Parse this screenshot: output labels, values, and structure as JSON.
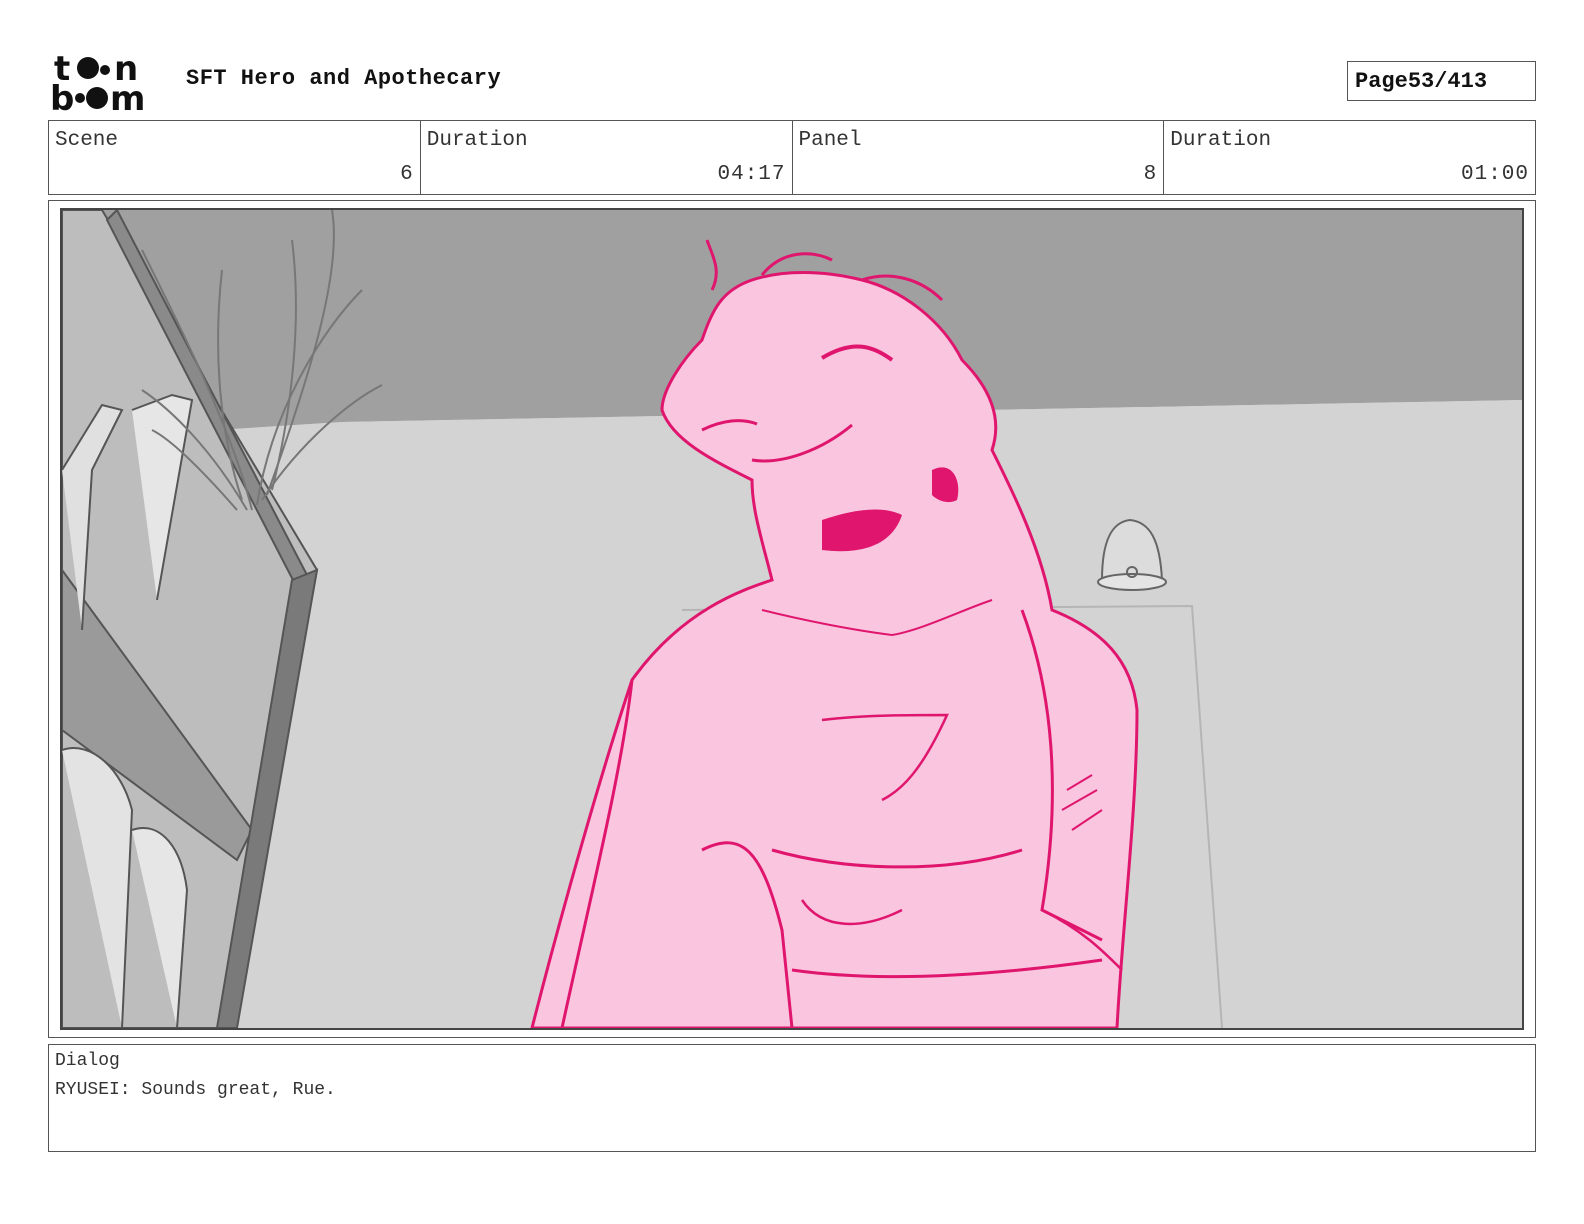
{
  "header": {
    "logo_text": "toon boom",
    "project_title": "SFT Hero and Apothecary",
    "page_label": "Page",
    "page_number": "53/413"
  },
  "info": {
    "scene_label": "Scene",
    "scene_value": "6",
    "scene_duration_label": "Duration",
    "scene_duration_value": "04:17",
    "panel_label": "Panel",
    "panel_value": "8",
    "panel_duration_label": "Duration",
    "panel_duration_value": "01:00"
  },
  "dialog": {
    "label": "Dialog",
    "text": "RYUSEI: Sounds great, Rue."
  },
  "colors": {
    "sketch_pink_fill": "#f9c5df",
    "sketch_pink_line": "#e0166e",
    "ceiling_gray": "#a0a0a0",
    "wall_gray": "#d3d3d3",
    "shelf_dark_gray": "#8a8a8a"
  }
}
